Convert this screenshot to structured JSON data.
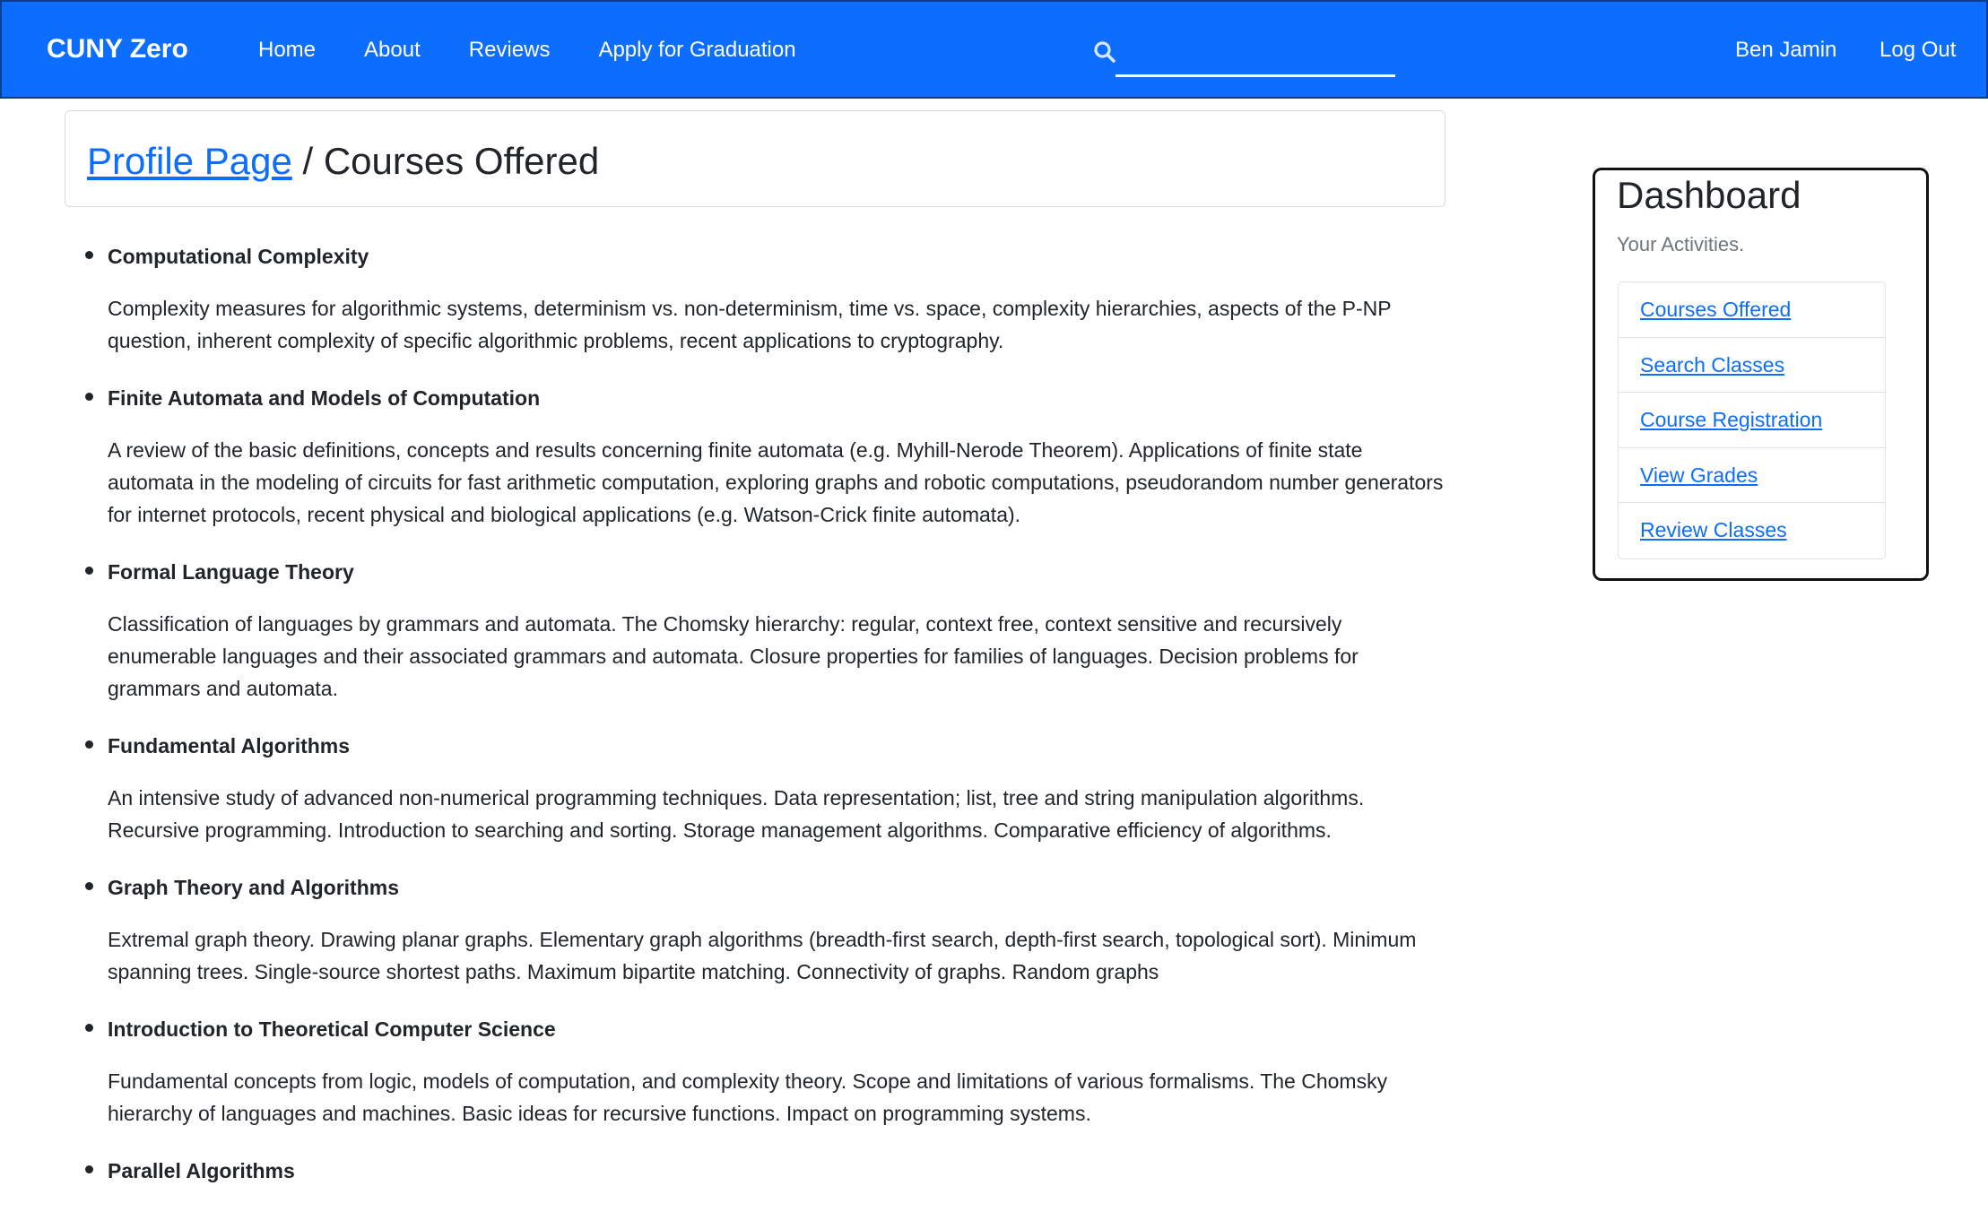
{
  "navbar": {
    "brand": "CUNY Zero",
    "links": [
      "Home",
      "About",
      "Reviews",
      "Apply for Graduation"
    ],
    "search": {
      "value": "",
      "icon": "search-icon"
    },
    "user": "Ben Jamin",
    "logout": "Log Out"
  },
  "breadcrumb": {
    "link": "Profile Page",
    "separator": " / ",
    "current": "Courses Offered"
  },
  "courses": [
    {
      "title": "Computational Complexity",
      "desc": "Complexity measures for algorithmic systems, determinism vs. non-determinism, time vs. space, complexity hierarchies, aspects of the P-NP question, inherent complexity of specific algorithmic problems, recent applications to cryptography."
    },
    {
      "title": "Finite Automata and Models of Computation",
      "desc": "A review of the basic definitions, concepts and results concerning finite automata (e.g. Myhill-Nerode Theorem). Applications of finite state automata in the modeling of circuits for fast arithmetic computation, exploring graphs and robotic computations, pseudorandom number generators for internet protocols, recent physical and biological applications (e.g. Watson-Crick finite automata)."
    },
    {
      "title": "Formal Language Theory",
      "desc": "Classification of languages by grammars and automata. The Chomsky hierarchy: regular, context free, context sensitive and recursively enumerable languages and their associated grammars and automata. Closure properties for families of languages. Decision problems for grammars and automata."
    },
    {
      "title": "Fundamental Algorithms",
      "desc": "An intensive study of advanced non-numerical programming techniques. Data representation; list, tree and string manipulation algorithms. Recursive programming. Introduction to searching and sorting. Storage management algorithms. Comparative efficiency of algorithms."
    },
    {
      "title": "Graph Theory and Algorithms",
      "desc": "Extremal graph theory. Drawing planar graphs. Elementary graph algorithms (breadth-first search, depth-first search, topological sort). Minimum spanning trees. Single-source shortest paths. Maximum bipartite matching. Connectivity of graphs. Random graphs"
    },
    {
      "title": "Introduction to Theoretical Computer Science",
      "desc": "Fundamental concepts from logic, models of computation, and complexity theory. Scope and limitations of various formalisms. The Chomsky hierarchy of languages and machines. Basic ideas for recursive functions. Impact on programming systems."
    },
    {
      "title": "Parallel Algorithms",
      "desc": ""
    }
  ],
  "dashboard": {
    "title": "Dashboard",
    "subtitle": "Your Activities.",
    "items": [
      "Courses Offered",
      "Search Classes",
      "Course Registration",
      "View Grades",
      "Review Classes"
    ]
  }
}
